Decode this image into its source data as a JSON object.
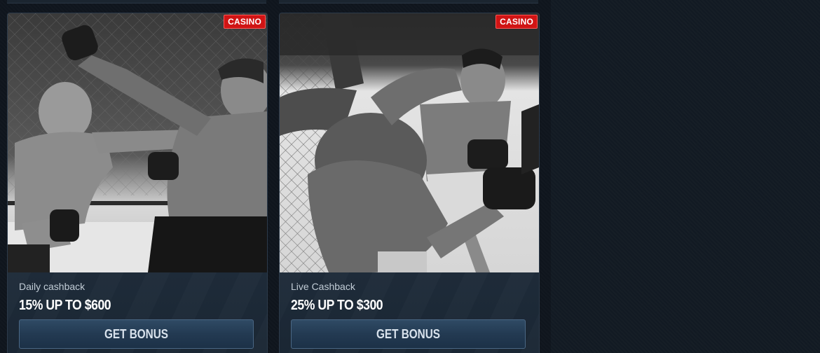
{
  "cards": [
    {
      "badge": "CASINO",
      "subtitle": "Daily cashback",
      "title": "15% UP TO $600",
      "button_label": "GET BONUS",
      "image_subject": "two mma fighters exchanging punches in the cage"
    },
    {
      "badge": "CASINO",
      "subtitle": "Live Cashback",
      "title": "25% UP TO $300",
      "button_label": "GET BONUS",
      "image_subject": "mma fighter taking a punch near the octagon fence"
    }
  ],
  "colors": {
    "badge": "#d01414",
    "card_background": "#1a2633",
    "button": "#2f4a64",
    "page_background": "#0f151d"
  }
}
